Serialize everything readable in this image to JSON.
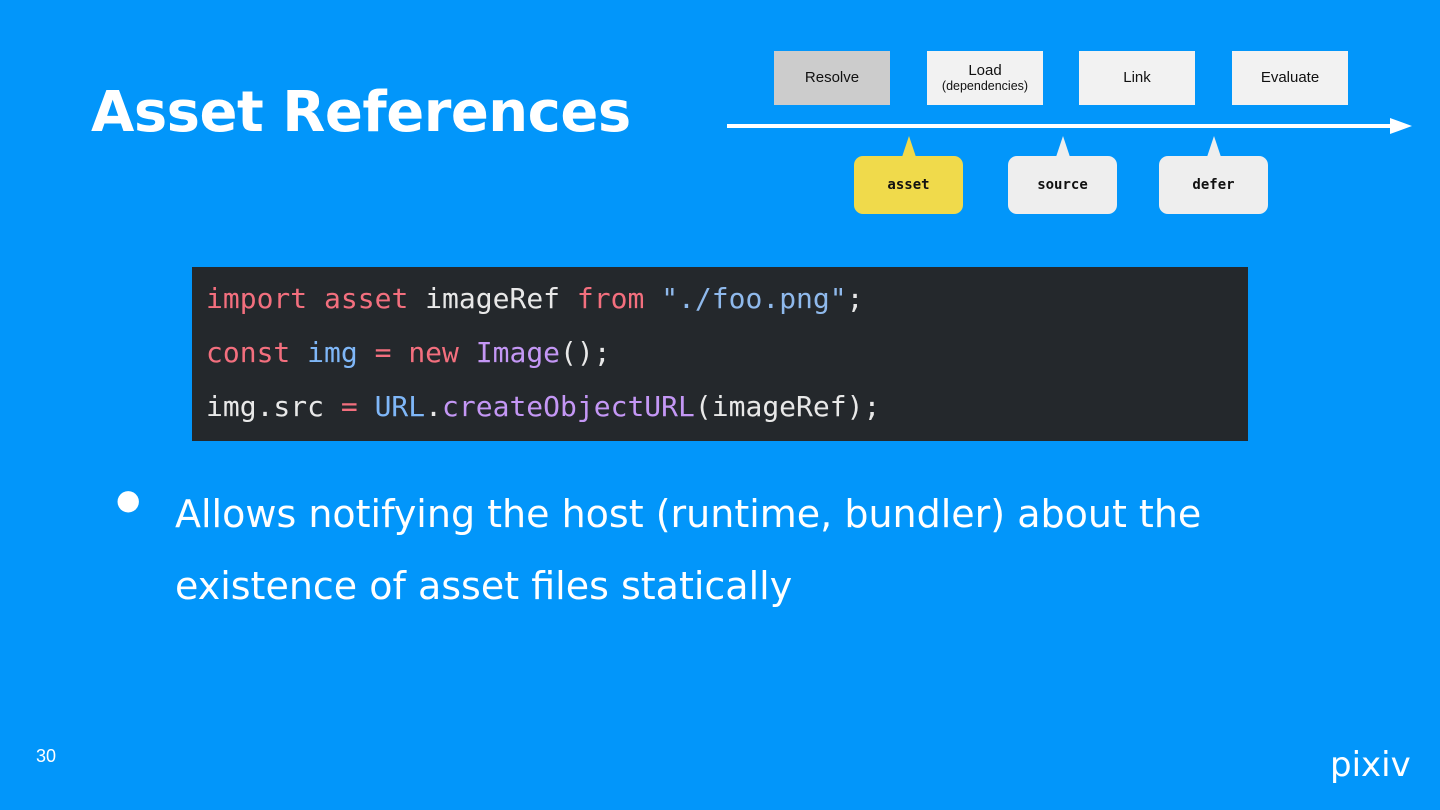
{
  "slide": {
    "title": "Asset References",
    "page_number": "30",
    "logo_text": "pixiv"
  },
  "pipeline": {
    "stages": [
      {
        "label": "Resolve",
        "sub": ""
      },
      {
        "label": "Load",
        "sub": "(dependencies)"
      },
      {
        "label": "Link",
        "sub": ""
      },
      {
        "label": "Evaluate",
        "sub": ""
      }
    ],
    "callouts": [
      "asset",
      "source",
      "defer"
    ]
  },
  "code": {
    "line1": {
      "t1": "import",
      "t2": " ",
      "t3": "asset",
      "t4": " imageRef ",
      "t5": "from",
      "t6": " ",
      "t7": "\"./foo.png\"",
      "t8": ";"
    },
    "line2": {
      "t1": "const",
      "t2": " ",
      "t3": "img",
      "t4": " ",
      "t5": "=",
      "t6": " ",
      "t7": "new",
      "t8": " ",
      "t9": "Image",
      "t10": "();"
    },
    "line3": {
      "t1": "img.src ",
      "t2": "=",
      "t3": " ",
      "t4": "URL",
      "t5": ".",
      "t6": "createObjectURL",
      "t7": "(imageRef);"
    }
  },
  "bullets": [
    {
      "marker": "●",
      "text": "Allows notifying the host (runtime, bundler) about the existence of asset files statically"
    }
  ],
  "colors": {
    "background": "#0296fa",
    "resolve_box": "#cccccc",
    "stage_box": "#f2f2f2",
    "asset_callout": "#f0da4b",
    "code_bg": "#24282c",
    "keyword": "#f36f7e",
    "identifier": "#7fb7f8",
    "function": "#c497f5"
  }
}
